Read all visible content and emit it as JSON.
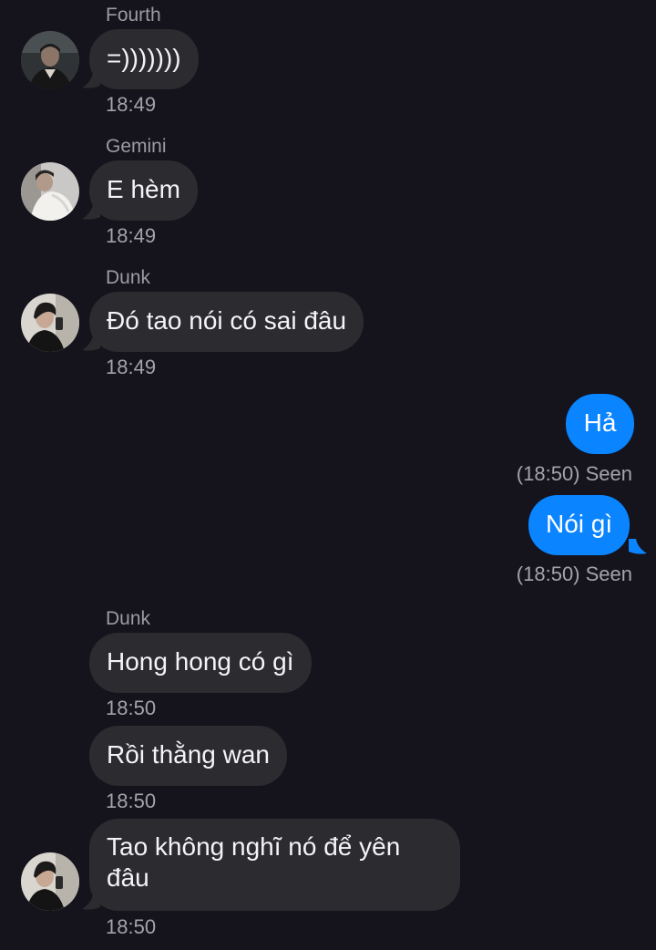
{
  "colors": {
    "background": "#15131b",
    "incoming_bubble": "#2c2b30",
    "outgoing_bubble": "#0a84ff",
    "meta_text": "#a4a2aa"
  },
  "messages": [
    {
      "sender": "Fourth",
      "text": "=)))))))",
      "time": "18:49",
      "avatar": "avatar-fourth"
    },
    {
      "sender": "Gemini",
      "text": "E hèm",
      "time": "18:49",
      "avatar": "avatar-gemini"
    },
    {
      "sender": "Dunk",
      "text": "Đó tao nói có sai đâu",
      "time": "18:49",
      "avatar": "avatar-dunk"
    },
    {
      "sender": "me",
      "text": "Hả",
      "time": "(18:50) Seen"
    },
    {
      "sender": "me",
      "text": "Nói gì",
      "time": "(18:50) Seen"
    },
    {
      "sender": "Dunk",
      "text": "Hong hong có gì",
      "time": "18:50"
    },
    {
      "sender": "Dunk",
      "text": "Rồi thằng wan",
      "time": "18:50"
    },
    {
      "sender": "Dunk",
      "text": "Tao không nghĩ nó để yên đâu",
      "time": "18:50",
      "avatar": "avatar-dunk"
    }
  ]
}
